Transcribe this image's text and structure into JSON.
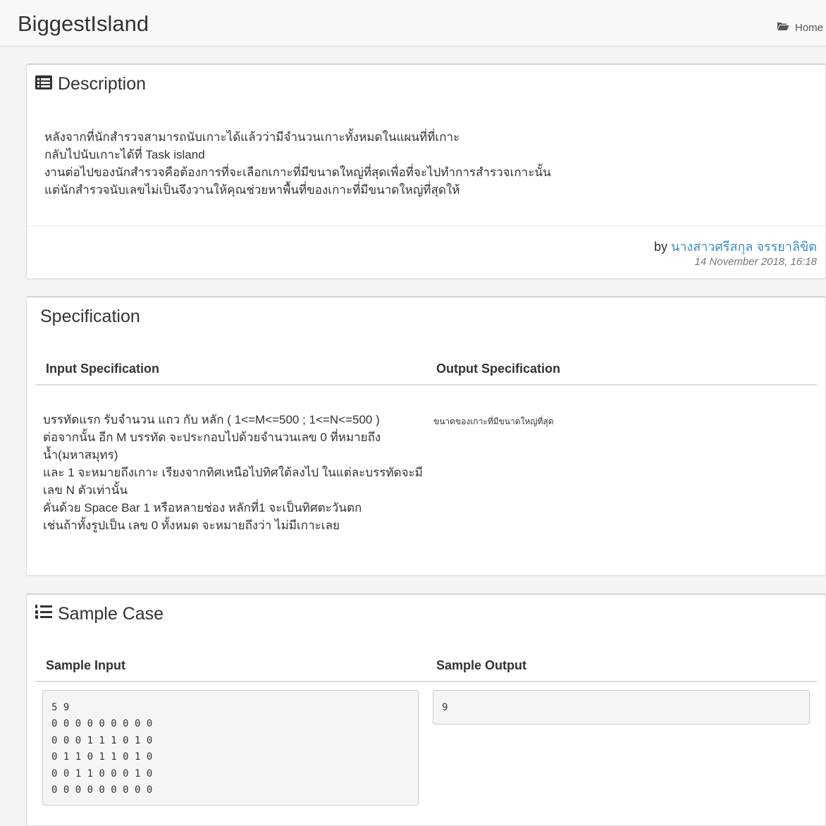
{
  "navbar": {
    "brand": "BiggestIsland",
    "home_label": "Home",
    "home_icon": "folder-open-icon"
  },
  "description": {
    "title": "Description",
    "title_icon": "list-alt-icon",
    "lines": [
      "หลังจากที่นักสำรวจสามารถนับเกาะได้แล้วว่ามีจำนวนเกาะทั้งหมดในแผนที่ที่เกาะ",
      "กลับไปนับเกาะได้ที่ Task island",
      "งานต่อไปของนักสำรวจคือต้องการที่จะเลือกเกาะที่มีขนาดใหญ่ที่สุดเพื่อที่จะไปทำการสำรวจเกาะนั้น",
      "แต่นักสำรวจนับเลขไม่เป็นจึงวานให้คุณช่วยหาพื้นที่ของเกาะที่มีขนาดใหญ่ที่สุดให้"
    ],
    "by_prefix": "by",
    "author": "นางสาวศรีสกุล จรรยาลิขิต",
    "timestamp": "14 November 2018, 16:18"
  },
  "specification": {
    "title": "Specification",
    "input_header": "Input Specification",
    "output_header": "Output Specification",
    "input_lines": [
      "บรรทัดแรก รับจำนวน แถว กับ หลัก ( 1<=M<=500 ; 1<=N<=500 )",
      "ต่อจากนั้น อีก M บรรทัด จะประกอบไปด้วยจำนวนเลข 0 ที่หมายถึง",
      "น้ำ(มหาสมุทร)",
      "และ 1 จะหมายถึงเกาะ เรียงจากทิศเหนือไปทิศใต้ลงไป ในแต่ละบรรทัดจะมี",
      "เลข N ตัวเท่านั้น",
      "คั่นด้วย Space Bar 1 หรือหลายช่อง หลักที่1 จะเป็นทิศตะวันตก",
      "เช่นถ้าทั้งรูปเป็น เลข 0 ทั้งหมด จะหมายถึงว่า ไม่มีเกาะเลย"
    ],
    "output_text": "ขนาดของเกาะที่มีขนาดใหญ่ที่สุด"
  },
  "sample": {
    "title": "Sample Case",
    "title_icon": "list-ol-icon",
    "input_header": "Sample Input",
    "output_header": "Sample Output",
    "input_code": "5 9\n0 0 0 0 0 0 0 0 0\n0 0 0 1 1 1 0 1 0\n0 1 1 0 1 1 0 1 0\n0 0 1 1 0 0 0 1 0\n0 0 0 0 0 0 0 0 0",
    "output_code": "9"
  },
  "colors": {
    "link": "#3c8dbc",
    "navbar_bg": "#f8f8f8",
    "page_bg": "#f4f4f4"
  }
}
